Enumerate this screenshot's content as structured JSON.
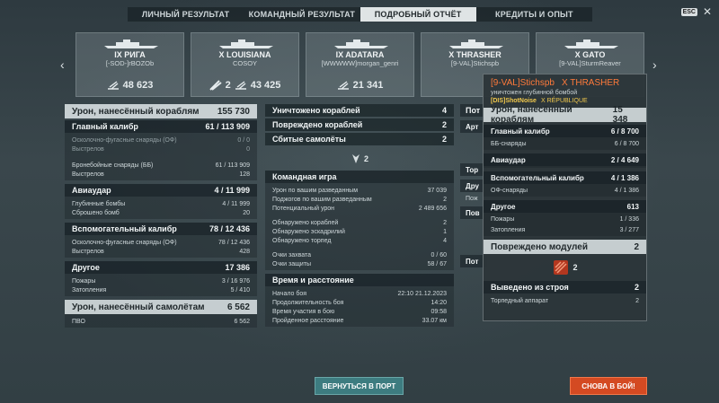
{
  "tabs": [
    "ЛИЧНЫЙ РЕЗУЛЬТАТ",
    "КОМАНДНЫЙ РЕЗУЛЬТАТ",
    "ПОДРОБНЫЙ ОТЧЁТ",
    "КРЕДИТЫ И ОПЫТ"
  ],
  "active_tab": "ПОДРОБНЫЙ ОТЧЁТ",
  "esc_label": "ESC",
  "close_glyph": "✕",
  "arrows": {
    "left": "‹",
    "right": "›"
  },
  "ships": [
    {
      "name": "IX РИГА",
      "player": "[-SOD-]rBOZOb",
      "kills": "",
      "damage": "48 623"
    },
    {
      "name": "X LOUISIANA",
      "player": "COSOY",
      "kills": "2",
      "damage": "43 425"
    },
    {
      "name": "IX ADATARA",
      "player": "[WWWWW]morgan_genri",
      "kills": "",
      "damage": "21 341"
    },
    {
      "name": "X THRASHER",
      "player": "[9-VAL]Stichspb",
      "kills": "",
      "damage": ""
    },
    {
      "name": "X GATO",
      "player": "[9-VAL]SturmReaver",
      "kills": "",
      "damage": ""
    }
  ],
  "damage": {
    "title": "Урон, нанесённый кораблям",
    "total": "155 730",
    "main": {
      "label": "Главный калибр",
      "value": "61 / 113 909",
      "rows": [
        [
          "Осколочно-фугасные снаряды (ОФ)",
          "0 / 0"
        ],
        [
          "Выстрелов",
          "0"
        ],
        [
          "Бронебойные снаряды (ББ)",
          "61 / 113 909"
        ],
        [
          "Выстрелов",
          "128"
        ]
      ]
    },
    "air": {
      "label": "Авиаудар",
      "value": "4 / 11 999",
      "rows": [
        [
          "Глубинные бомбы",
          "4 / 11 999"
        ],
        [
          "Сброшено бомб",
          "20"
        ]
      ]
    },
    "sec": {
      "label": "Вспомогательный калибр",
      "value": "78 / 12 436",
      "rows": [
        [
          "Осколочно-фугасные снаряды (ОФ)",
          "78 / 12 436"
        ],
        [
          "Выстрелов",
          "428"
        ]
      ]
    },
    "other": {
      "label": "Другое",
      "value": "17 386",
      "rows": [
        [
          "Пожары",
          "3 / 16 976"
        ],
        [
          "Затопления",
          "5 / 410"
        ]
      ]
    },
    "planes": {
      "label": "Урон, нанесённый самолётам",
      "value": "6 562",
      "rows": [
        [
          "ПВО",
          "6 562"
        ]
      ]
    }
  },
  "middle": {
    "summary": [
      [
        "Уничтожено кораблей",
        "4"
      ],
      [
        "Повреждено кораблей",
        "2"
      ],
      [
        "Сбитые самолёты",
        "2"
      ]
    ],
    "plane_icon_count": "2",
    "team": {
      "title": "Командная игра",
      "rows": [
        [
          "Урон по вашим разведанным",
          "37 039"
        ],
        [
          "Поджогов по вашим разведанным",
          "2"
        ],
        [
          "Потенциальный урон",
          "2 489 656"
        ],
        [
          "Обнаружено кораблей",
          "2"
        ],
        [
          "Обнаружено эскадрилий",
          "1"
        ],
        [
          "Обнаружено торпед",
          "4"
        ],
        [
          "Очки захвата",
          "0 / 60"
        ],
        [
          "Очки защиты",
          "58 / 67"
        ]
      ]
    },
    "time": {
      "title": "Время и расстояние",
      "rows": [
        [
          "Начало боя",
          "22:10   21.12.2023"
        ],
        [
          "Продолжительность боя",
          "14:20"
        ],
        [
          "Время участия в бою",
          "09:58"
        ],
        [
          "Пройденное расстояние",
          "33.07 км"
        ]
      ]
    }
  },
  "right_partial": [
    [
      "Пот",
      ""
    ],
    [
      "Арт",
      ""
    ],
    [
      "Тор",
      ""
    ],
    [
      "Дру",
      ""
    ],
    [
      "Пож",
      ""
    ],
    [
      "Пов",
      ""
    ],
    [
      "Пот",
      ""
    ]
  ],
  "popup": {
    "player": "[9-VAL]Stichspb",
    "ship": "X THRASHER",
    "destroyed_by": "уничтожен глубинной бомбой",
    "killer": "[DIS]ShotNoise",
    "killer_ship": "X RÉPUBLIQUE",
    "damage_title": "Урон, нанесённый кораблям",
    "damage_total": "15 348",
    "groups": [
      {
        "label": "Главный калибр",
        "value": "6 / 8 700",
        "rows": [
          [
            "ББ-снаряды",
            "6 / 8 700"
          ]
        ]
      },
      {
        "label": "Авиаудар",
        "value": "2 / 4 649",
        "rows": []
      },
      {
        "label": "Вспомогательный калибр",
        "value": "4 / 1 386",
        "rows": [
          [
            "ОФ-снаряды",
            "4 / 1 386"
          ]
        ]
      },
      {
        "label": "Другое",
        "value": "613",
        "rows": [
          [
            "Пожары",
            "1 / 336"
          ],
          [
            "Затопления",
            "3 / 277"
          ]
        ]
      }
    ],
    "modules_title": "Повреждено модулей",
    "modules_value": "2",
    "module_icon_count": "2",
    "disabled_title": "Выведено из строя",
    "disabled_value": "2",
    "disabled_rows": [
      [
        "Торпедный аппарат",
        "2"
      ]
    ]
  },
  "buttons": {
    "port": "ВЕРНУТЬСЯ В ПОРТ",
    "battle": "СНОВА В БОЙ!"
  }
}
